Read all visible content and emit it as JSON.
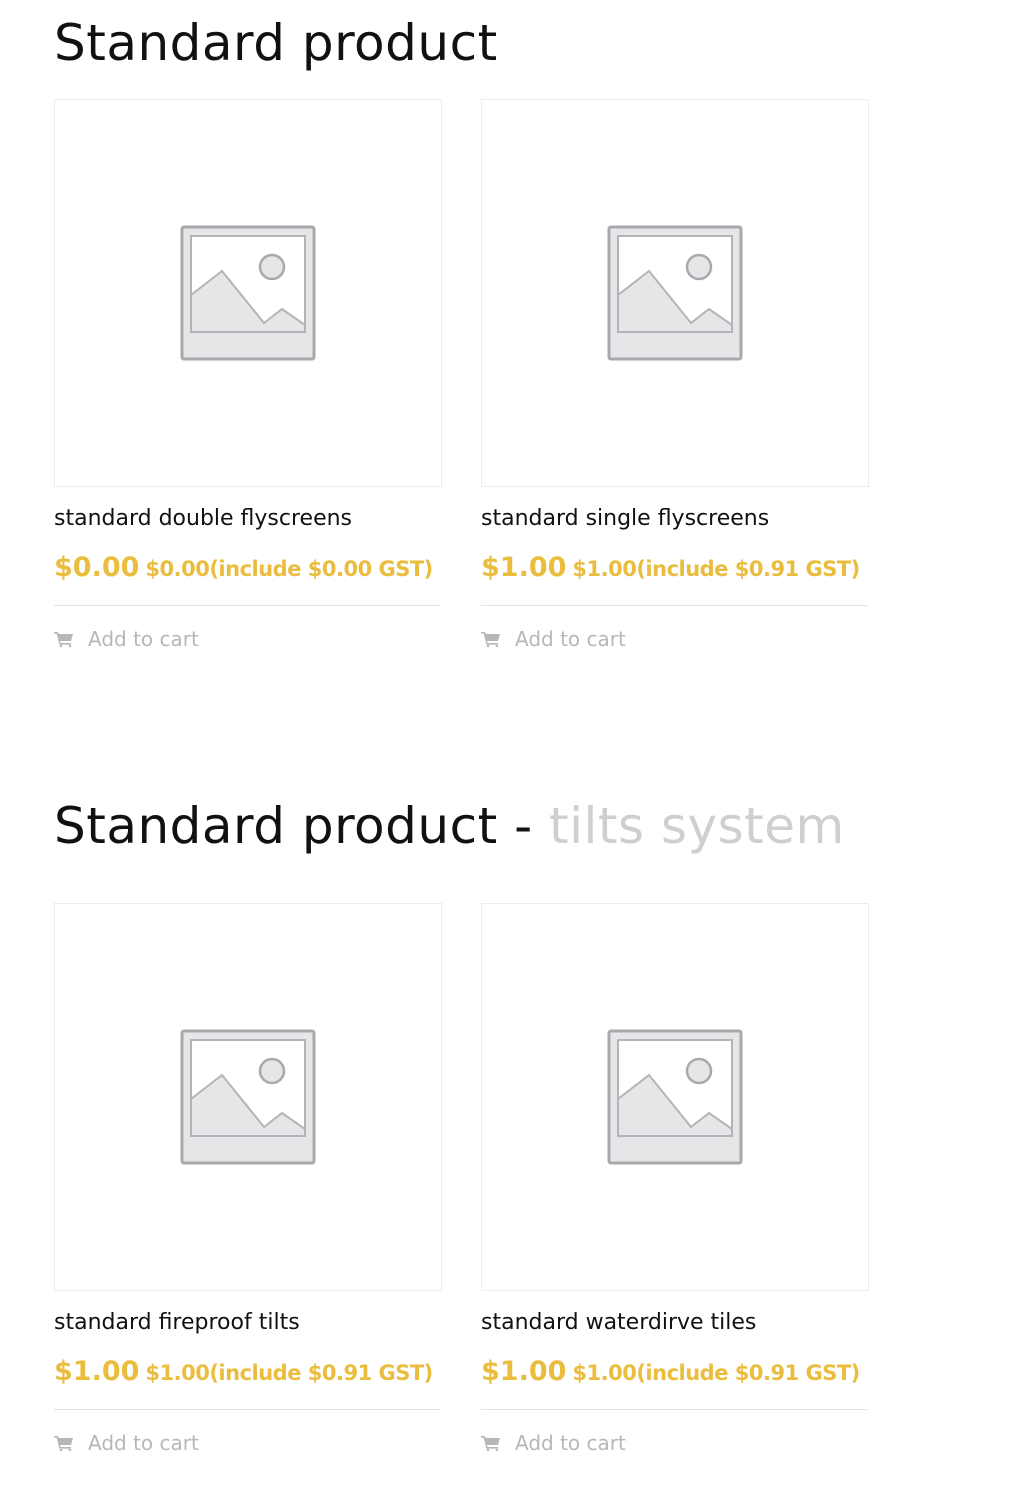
{
  "sections": [
    {
      "title": "Standard product",
      "title_suffix_sep": "",
      "title_suffix": "",
      "products": [
        {
          "name": "standard double flyscreens",
          "price": "$0.00",
          "price_incl": "$0.00(include $0.00 GST)",
          "add_to_cart": "Add to cart"
        },
        {
          "name": "standard single flyscreens",
          "price": "$1.00",
          "price_incl": "$1.00(include $0.91 GST)",
          "add_to_cart": "Add to cart"
        }
      ]
    },
    {
      "title": "Standard product",
      "title_suffix_sep": " - ",
      "title_suffix": "tilts system",
      "products": [
        {
          "name": "standard fireproof tilts",
          "price": "$1.00",
          "price_incl": "$1.00(include $0.91 GST)",
          "add_to_cart": "Add to cart"
        },
        {
          "name": "standard waterdirve tiles",
          "price": "$1.00",
          "price_incl": "$1.00(include $0.91 GST)",
          "add_to_cart": "Add to cart"
        }
      ]
    }
  ],
  "colors": {
    "price": "#ebbd3f",
    "muted_title": "#cfcfcf",
    "add_to_cart": "#b7b7b7"
  },
  "icons": {
    "placeholder": "image-placeholder-icon",
    "cart": "cart-icon"
  }
}
